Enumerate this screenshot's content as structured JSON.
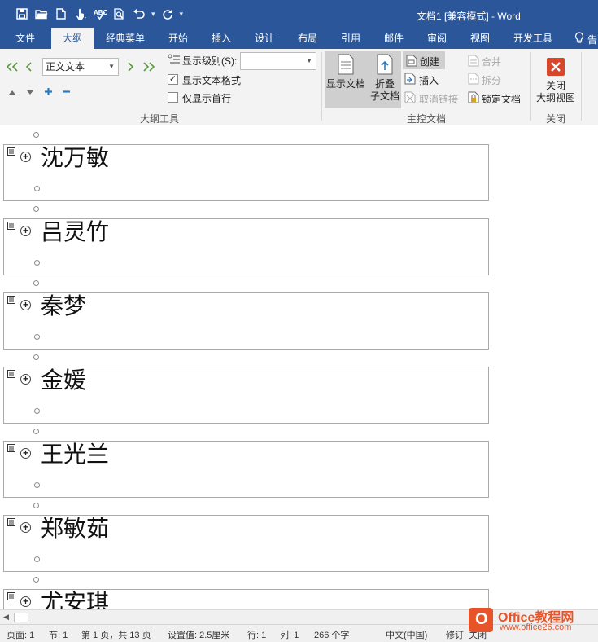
{
  "window": {
    "title": "文档1 [兼容模式] - Word"
  },
  "tabs": [
    {
      "label": "文件",
      "active": false
    },
    {
      "label": "大纲",
      "active": true
    },
    {
      "label": "经典菜单",
      "active": false
    },
    {
      "label": "开始",
      "active": false
    },
    {
      "label": "插入",
      "active": false
    },
    {
      "label": "设计",
      "active": false
    },
    {
      "label": "布局",
      "active": false
    },
    {
      "label": "引用",
      "active": false
    },
    {
      "label": "邮件",
      "active": false
    },
    {
      "label": "审阅",
      "active": false
    },
    {
      "label": "视图",
      "active": false
    },
    {
      "label": "开发工具",
      "active": false
    }
  ],
  "help_cut": "告",
  "ribbon": {
    "outline_tools": {
      "group_label": "大纲工具",
      "level_combo_value": "正文文本",
      "show_level_label": "显示级别(S):",
      "show_level_value": "",
      "show_text_format_label": "显示文本格式",
      "show_text_format_checked": true,
      "first_line_only_label": "仅显示首行",
      "first_line_only_checked": false
    },
    "master_document": {
      "group_label": "主控文档",
      "show_document_label": "显示文档",
      "collapse_line1": "折叠",
      "collapse_line2": "子文档",
      "create_label": "创建",
      "insert_label": "插入",
      "unlink_label": "取消链接",
      "merge_label": "合并",
      "split_label": "拆分",
      "lock_label": "锁定文档"
    },
    "close": {
      "group_label": "关闭",
      "close_line1": "关闭",
      "close_line2": "大纲视图"
    }
  },
  "document": {
    "subdocuments": [
      {
        "heading": "沈万敏"
      },
      {
        "heading": "吕灵竹"
      },
      {
        "heading": "秦梦"
      },
      {
        "heading": "金媛"
      },
      {
        "heading": "王光兰"
      },
      {
        "heading": "郑敏茹"
      },
      {
        "heading": "尤安琪"
      }
    ]
  },
  "status": {
    "page": "页面: 1",
    "section": "节: 1",
    "page_of": "第 1 页，共 13 页",
    "position": "设置值: 2.5厘米",
    "line": "行: 1",
    "column": "列: 1",
    "words": "266 个字",
    "language": "中文(中国)",
    "track_changes": "修订: 关闭"
  },
  "watermark": {
    "brand": "Office教程网",
    "url": "www.office26.com"
  }
}
